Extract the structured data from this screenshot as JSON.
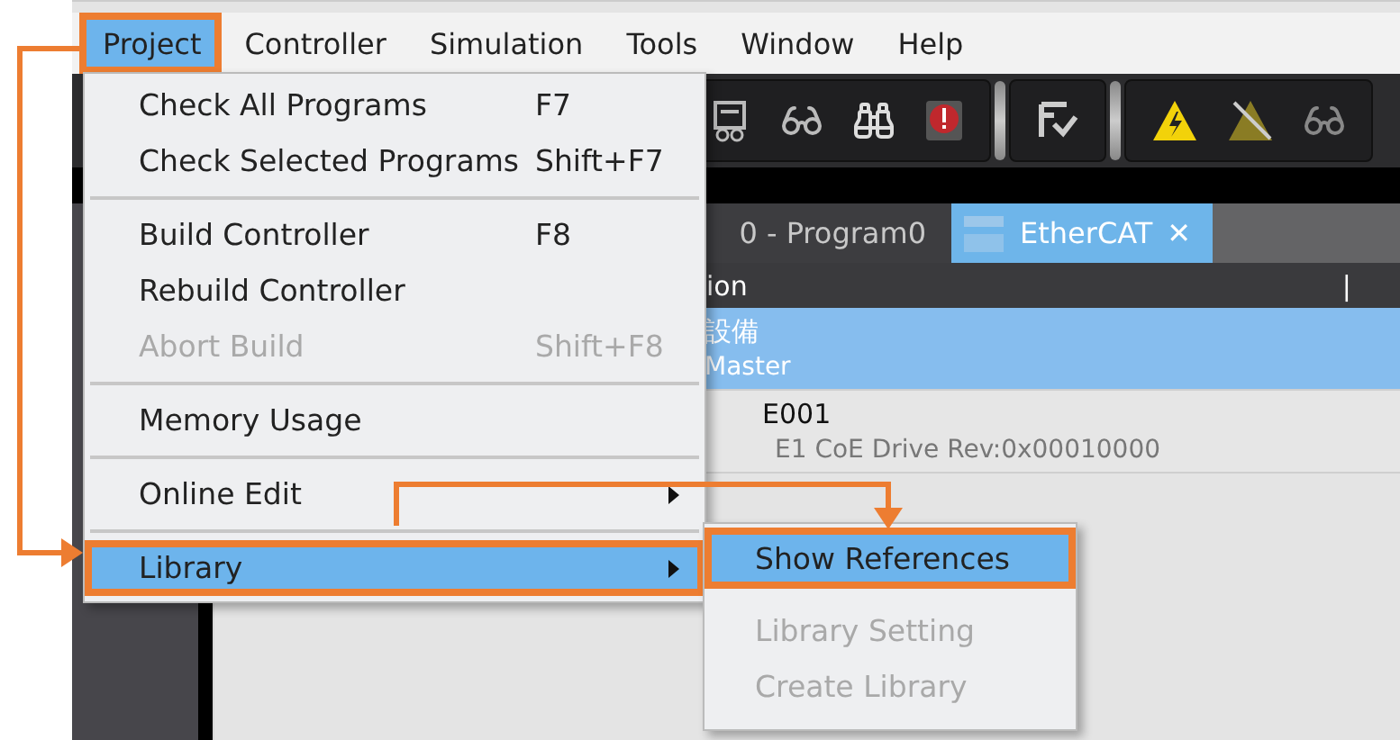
{
  "menu_bar": [
    {
      "label": "Project",
      "selected": true,
      "callout": true
    },
    {
      "label": "Controller",
      "selected": false,
      "callout": false
    },
    {
      "label": "Simulation",
      "selected": false,
      "callout": false
    },
    {
      "label": "Tools",
      "selected": false,
      "callout": false
    },
    {
      "label": "Window",
      "selected": false,
      "callout": false
    },
    {
      "label": "Help",
      "selected": false,
      "callout": false
    }
  ],
  "project_menu": [
    {
      "kind": "item",
      "label": "Check All Programs",
      "shortcut": "F7",
      "disabled": false,
      "selected": false,
      "callout": false
    },
    {
      "kind": "item",
      "label": "Check Selected Programs",
      "shortcut": "Shift+F7",
      "disabled": false,
      "selected": false,
      "callout": false
    },
    {
      "kind": "separator"
    },
    {
      "kind": "item",
      "label": "Build Controller",
      "shortcut": "F8",
      "disabled": false,
      "selected": false,
      "callout": false
    },
    {
      "kind": "item",
      "label": "Rebuild Controller",
      "disabled": false,
      "selected": false,
      "callout": false
    },
    {
      "kind": "item",
      "label": "Abort Build",
      "shortcut": "Shift+F8",
      "disabled": true,
      "selected": false,
      "callout": false
    },
    {
      "kind": "separator"
    },
    {
      "kind": "item",
      "label": "Memory Usage",
      "disabled": false,
      "selected": false,
      "callout": false
    },
    {
      "kind": "separator"
    },
    {
      "kind": "submenu",
      "label": "Online Edit",
      "disabled": false,
      "selected": false,
      "callout": false
    },
    {
      "kind": "separator"
    },
    {
      "kind": "submenu",
      "label": "Library",
      "disabled": false,
      "selected": true,
      "callout": true
    }
  ],
  "library_submenu": [
    {
      "label": "Show References",
      "disabled": false,
      "selected": true,
      "callout": true
    },
    {
      "label": "Library Setting",
      "disabled": true,
      "selected": false,
      "callout": false
    },
    {
      "label": "Create Library",
      "disabled": true,
      "selected": false,
      "callout": false
    }
  ],
  "tabs": [
    {
      "label": "0 - Program0",
      "selected": false,
      "closable": false
    },
    {
      "label": "EtherCAT",
      "selected": true,
      "closable": true,
      "close": "✕"
    }
  ],
  "table": {
    "columns": [
      "ion",
      "|"
    ],
    "rows": [
      {
        "title": "設備",
        "subtitle": "Master",
        "selected": true,
        "children": [
          {
            "title": "E001",
            "subtitle": "E1 CoE Drive Rev:0x00010000",
            "selected": false
          }
        ]
      }
    ]
  }
}
